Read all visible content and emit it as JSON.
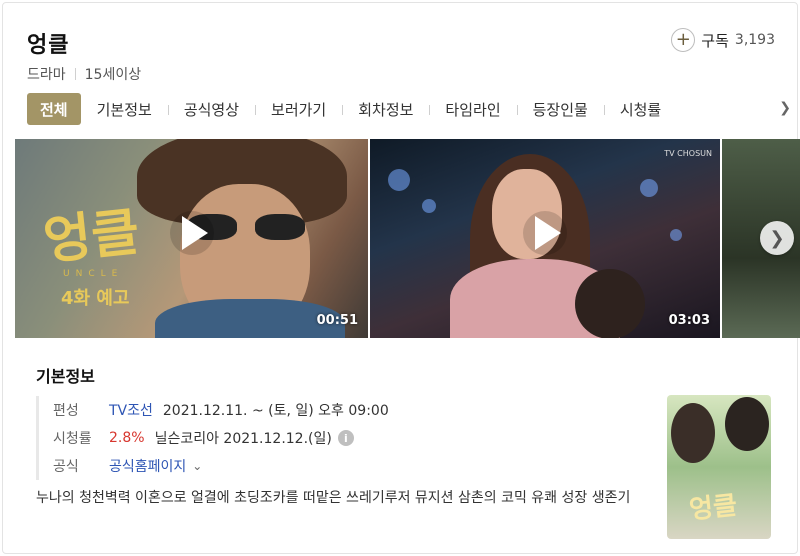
{
  "header": {
    "title": "엉클",
    "genre": "드라마",
    "rating": "15세이상",
    "subscribe_label": "구독",
    "subscribe_count": "3,193",
    "subscribe_icon": "plus-icon"
  },
  "tabs": [
    {
      "label": "전체",
      "active": true
    },
    {
      "label": "기본정보"
    },
    {
      "label": "공식영상"
    },
    {
      "label": "보러가기"
    },
    {
      "label": "회차정보"
    },
    {
      "label": "타임라인"
    },
    {
      "label": "등장인물"
    },
    {
      "label": "시청률"
    }
  ],
  "videos": [
    {
      "duration": "00:51",
      "thumb_title": "엉클",
      "thumb_subtitle": "UNCLE",
      "thumb_episode": "4화 예고"
    },
    {
      "duration": "03:03",
      "channel_logo": "TV CHOSUN"
    },
    {}
  ],
  "info": {
    "heading": "기본정보",
    "broadcast_key": "편성",
    "broadcast_channel": "TV조선",
    "broadcast_schedule": "2021.12.11. ~ (토, 일) 오후 09:00",
    "rating_key": "시청률",
    "rating_value": "2.8%",
    "rating_source": "닐슨코리아 2021.12.12.(일)",
    "official_key": "공식",
    "official_link": "공식홈페이지",
    "description": "누나의 청천벽력 이혼으로 얼결에 초딩조카를 떠맡은 쓰레기루저 뮤지션 삼촌의 코믹 유쾌 성장 생존기"
  },
  "poster": {
    "title": "엉클"
  },
  "colors": {
    "accent": "#a39566",
    "link": "#2e55b4",
    "rating_red": "#d7372f"
  }
}
